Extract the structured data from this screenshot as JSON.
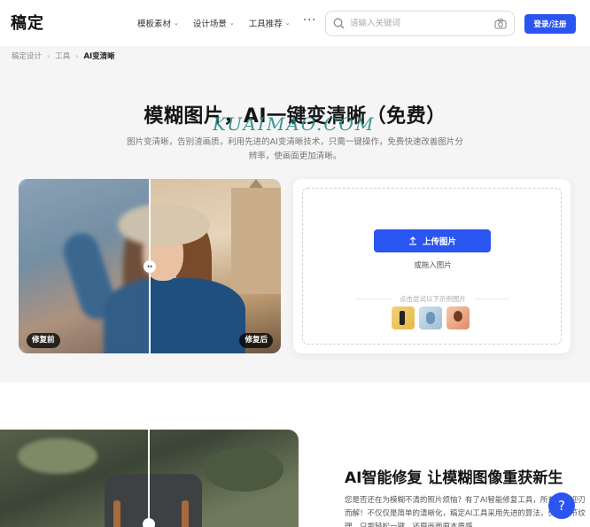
{
  "header": {
    "logo": "稿定",
    "nav": [
      {
        "label": "模板素材"
      },
      {
        "label": "设计场景"
      },
      {
        "label": "工具推荐"
      }
    ],
    "more": "···",
    "search_placeholder": "请输入关键词",
    "login_label": "登录/注册"
  },
  "breadcrumb": {
    "items": [
      "稿定设计",
      "工具",
      "AI变清晰"
    ]
  },
  "hero": {
    "title": "模糊图片，AI一键变清晰（免费）",
    "watermark": "KUAIMAO.COM",
    "subtitle": "图片变清晰，告别渣画质，利用先进的AI变清晰技术，只需一键操作，免费快速改善图片分辨率，使画面更加清晰。",
    "tag_before": "修复前",
    "tag_after": "修复后"
  },
  "upload": {
    "button_label": "上传图片",
    "drag_text": "或拖入图片",
    "sample_label": "点击尝试以下示例图片"
  },
  "section2": {
    "title": "AI智能修复 让模糊图像重获新生",
    "text": "您是否还在为模糊不清的照片烦恼？有了AI智能修复工具，所有问题迎刃而解！不仅仅是简单的清晰化，稿定AI工具采用先进的算法，优化细节纹理，只需轻松一键，还原画面原本质感。"
  },
  "help_label": "?",
  "colors": {
    "accent": "#2b55f0",
    "hero_bg": "#f5f5f6"
  }
}
